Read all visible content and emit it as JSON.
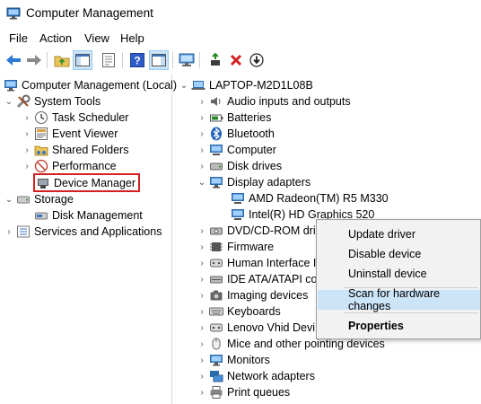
{
  "window": {
    "title": "Computer Management"
  },
  "menu": [
    "File",
    "Action",
    "View",
    "Help"
  ],
  "left_tree": {
    "root": "Computer Management (Local)",
    "system_tools": "System Tools",
    "system_items": [
      "Task Scheduler",
      "Event Viewer",
      "Shared Folders",
      "Performance",
      "Device Manager"
    ],
    "storage": "Storage",
    "storage_items": [
      "Disk Management"
    ],
    "services": "Services and Applications"
  },
  "right_tree": {
    "computer": "LAPTOP-M2D1L08B",
    "categories": [
      "Audio inputs and outputs",
      "Batteries",
      "Bluetooth",
      "Computer",
      "Disk drives",
      "Display adapters"
    ],
    "display_children": [
      "AMD Radeon(TM) R5 M330",
      "Intel(R) HD Graphics 520"
    ],
    "categories_after": [
      "DVD/CD-ROM dri",
      "Firmware",
      "Human Interface I",
      "IDE ATA/ATAPI con",
      "Imaging devices",
      "Keyboards",
      "Lenovo Vhid Devi",
      "Mice and other pointing devices",
      "Monitors",
      "Network adapters",
      "Print queues"
    ]
  },
  "context_menu": {
    "items": [
      "Update driver",
      "Disable device",
      "Uninstall device",
      "Scan for hardware changes",
      "Properties"
    ]
  }
}
